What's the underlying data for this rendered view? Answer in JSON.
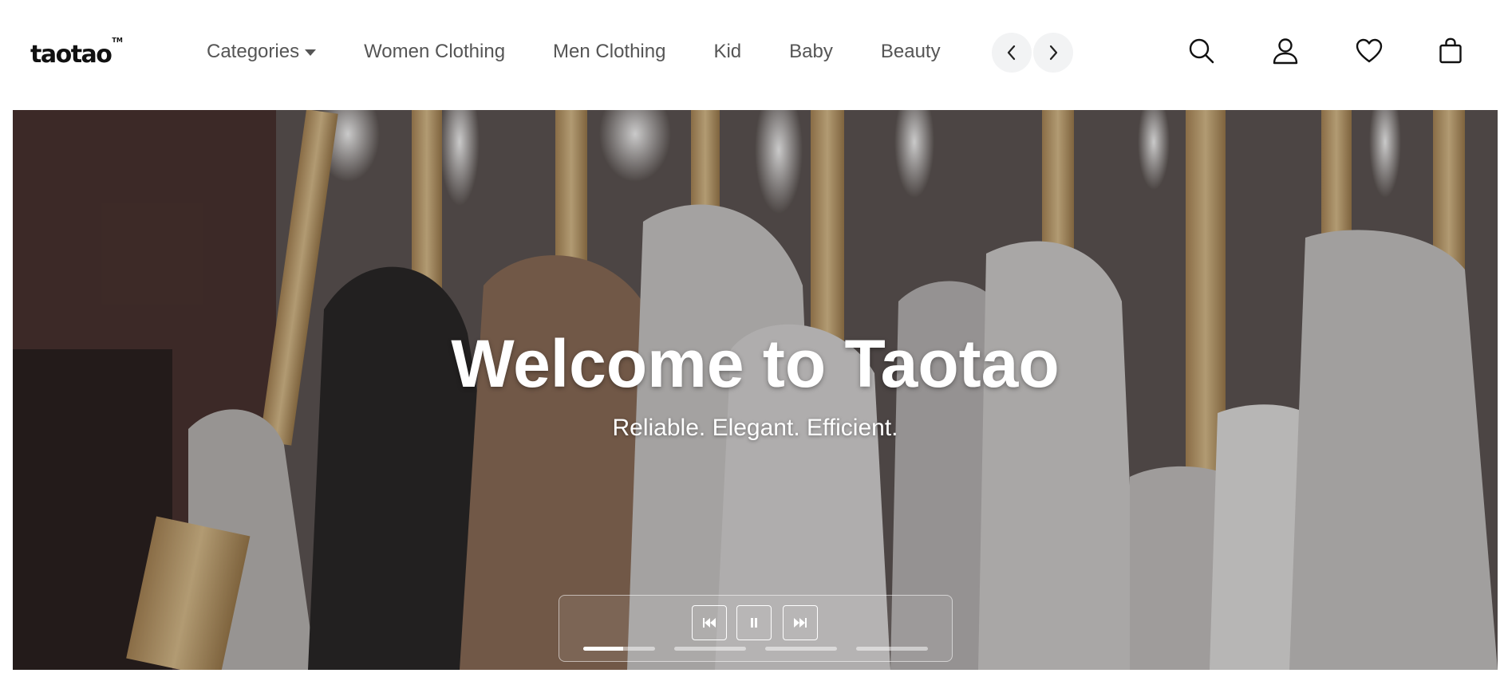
{
  "header": {
    "logo_text": "taotao",
    "logo_mark": "TM",
    "nav": [
      {
        "label": "Categories",
        "has_dropdown": true
      },
      {
        "label": "Women Clothing"
      },
      {
        "label": "Men Clothing"
      },
      {
        "label": "Kid"
      },
      {
        "label": "Baby"
      },
      {
        "label": "Beauty"
      }
    ],
    "icons": {
      "prev": "chevron-left-icon",
      "next": "chevron-right-icon",
      "search": "search-icon",
      "account": "user-icon",
      "wishlist": "heart-icon",
      "cart": "shopping-bag-icon"
    }
  },
  "hero": {
    "title": "Welcome to Taotao",
    "subtitle": "Reliable. Elegant. Efficient.",
    "controls": {
      "icons": [
        "skip-back-icon",
        "pause-icon",
        "skip-forward-icon"
      ],
      "slides": [
        {
          "progress": 0.55
        },
        {
          "progress": 0
        },
        {
          "progress": 0
        },
        {
          "progress": 0
        }
      ]
    }
  },
  "colors": {
    "nav_text": "#555555",
    "arrow_bg": "#f2f3f4",
    "hero_text": "#ffffff"
  }
}
